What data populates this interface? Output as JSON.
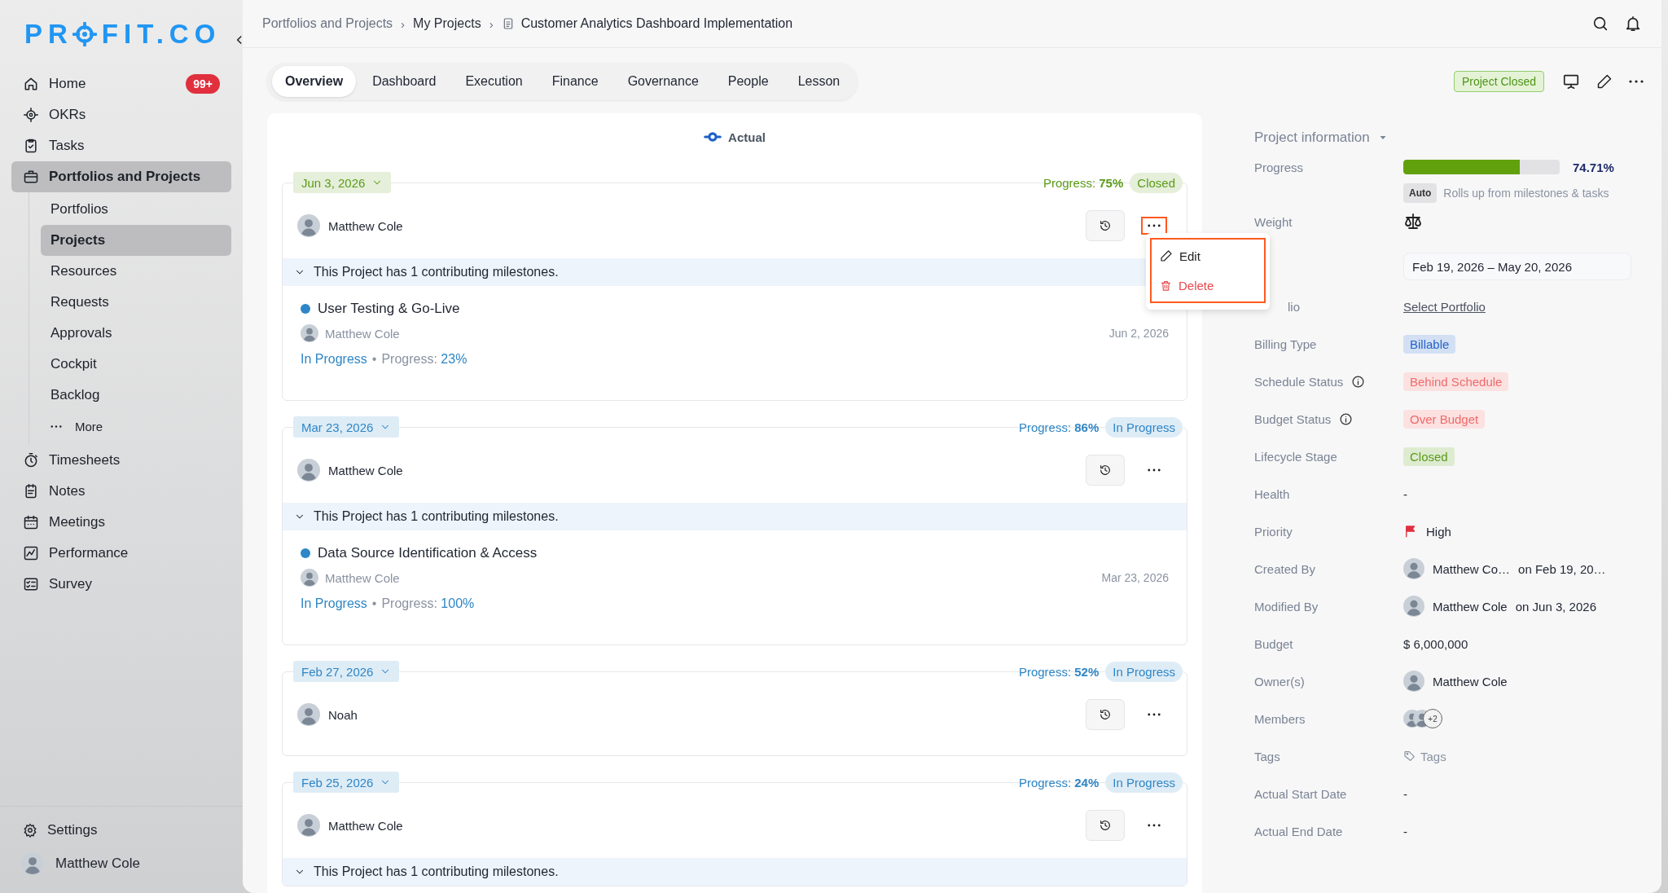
{
  "sidebar": {
    "logo": {
      "before": "PR",
      "after": "FIT.CO"
    },
    "items": [
      {
        "label": "Home",
        "badge": "99+",
        "selected": false
      },
      {
        "label": "OKRs",
        "selected": false
      },
      {
        "label": "Tasks",
        "selected": false
      },
      {
        "label": "Portfolios and Projects",
        "selected": true,
        "children": [
          {
            "label": "Portfolios",
            "selected": false
          },
          {
            "label": "Projects",
            "selected": true
          },
          {
            "label": "Resources",
            "selected": false
          },
          {
            "label": "Requests",
            "selected": false
          },
          {
            "label": "Approvals",
            "selected": false
          },
          {
            "label": "Cockpit",
            "selected": false
          },
          {
            "label": "Backlog",
            "selected": false
          },
          {
            "label": "More",
            "kind": "more",
            "selected": false
          }
        ]
      },
      {
        "label": "Timesheets",
        "selected": false
      },
      {
        "label": "Notes",
        "selected": false
      },
      {
        "label": "Meetings",
        "selected": false
      },
      {
        "label": "Performance",
        "selected": false
      },
      {
        "label": "Survey",
        "selected": false
      }
    ],
    "footer": {
      "settings": "Settings",
      "user": "Matthew Cole"
    }
  },
  "breadcrumb": {
    "separator": "›",
    "items": [
      "Portfolios and Projects",
      "My Projects",
      "Customer Analytics Dashboard Implementation"
    ]
  },
  "tabs": [
    {
      "label": "Overview",
      "selected": true
    },
    {
      "label": "Dashboard",
      "selected": false
    },
    {
      "label": "Execution",
      "selected": false
    },
    {
      "label": "Finance",
      "selected": false
    },
    {
      "label": "Governance",
      "selected": false
    },
    {
      "label": "People",
      "selected": false
    },
    {
      "label": "Lesson",
      "selected": false
    }
  ],
  "project_status": "Project Closed",
  "timeline": {
    "title": "Actual",
    "entries": [
      {
        "date": "Jun 3, 2026",
        "color": "#5b9c18",
        "progress_label": "Progress:",
        "progress": "75%",
        "status": "Closed",
        "owner": "Matthew Cole",
        "more_highlighted": true,
        "menu": {
          "highlighted": true,
          "items": [
            {
              "label": "Edit",
              "kind": "edit"
            },
            {
              "label": "Delete",
              "kind": "delete"
            }
          ]
        },
        "banner": "This Project has 1 contributing milestones.",
        "milestones": [
          {
            "title": "User Testing & Go-Live",
            "owner": "Matthew Cole",
            "date": "Jun 2, 2026",
            "status": "In Progress",
            "separator": "•",
            "progress_label": "Progress:",
            "progress": "23%"
          }
        ]
      },
      {
        "date": "Mar 23, 2026",
        "color": "#2f86c6",
        "progress_label": "Progress:",
        "progress": "86%",
        "status": "In Progress",
        "owner": "Matthew Cole",
        "more_highlighted": false,
        "banner": "This Project has 1 contributing milestones.",
        "milestones": [
          {
            "title": "Data Source Identification & Access",
            "owner": "Matthew Cole",
            "date": "Mar 23, 2026",
            "status": "In Progress",
            "separator": "•",
            "progress_label": "Progress:",
            "progress": "100%"
          }
        ]
      },
      {
        "date": "Feb 27, 2026",
        "color": "#2f86c6",
        "progress_label": "Progress:",
        "progress": "52%",
        "status": "In Progress",
        "owner": "Noah",
        "more_highlighted": false
      },
      {
        "date": "Feb 25, 2026",
        "color": "#2f86c6",
        "progress_label": "Progress:",
        "progress": "24%",
        "status": "In Progress",
        "owner": "Matthew Cole",
        "more_highlighted": false,
        "banner": "This Project has 1 contributing milestones."
      }
    ]
  },
  "info": {
    "title": "Project information",
    "rows": [
      {
        "kind": "progress",
        "label": "Progress",
        "level": 0.7471,
        "value": "74.71%",
        "badge": "Auto",
        "note": "Rolls up from milestones & tasks"
      },
      {
        "kind": "scale",
        "label": "Weight"
      },
      {
        "kind": "range",
        "value": "Feb 19, 2026 – May 20, 2026"
      },
      {
        "kind": "link",
        "label": "lio",
        "covered": true,
        "value": "Select Portfolio"
      },
      {
        "kind": "tag",
        "label": "Billing Type",
        "color": "#2563c9",
        "value": "Billable"
      },
      {
        "kind": "tag",
        "label": "Schedule Status",
        "info": true,
        "color": "#ef6b6b",
        "value": "Behind Schedule"
      },
      {
        "kind": "tag",
        "label": "Budget Status",
        "info": true,
        "color": "#ef6a6a",
        "value": "Over Budget"
      },
      {
        "kind": "tag",
        "label": "Lifecycle Stage",
        "color": "#5a9a17",
        "value": "Closed"
      },
      {
        "kind": "text",
        "label": "Health",
        "value": "-"
      },
      {
        "kind": "flag",
        "label": "Priority",
        "value": "High"
      },
      {
        "kind": "person",
        "label": "Created By",
        "value": "Matthew Co…",
        "suffix": "on Feb 19, 20…"
      },
      {
        "kind": "person",
        "label": "Modified By",
        "value": "Matthew Cole",
        "suffix": "on Jun 3, 2026"
      },
      {
        "kind": "text",
        "label": "Budget",
        "value": "$ 6,000,000"
      },
      {
        "kind": "person",
        "label": "Owner(s)",
        "value": "Matthew Cole"
      },
      {
        "kind": "members",
        "label": "Members",
        "value": "+2"
      },
      {
        "kind": "tags",
        "label": "Tags",
        "value": "Tags"
      },
      {
        "kind": "text",
        "label": "Actual Start Date",
        "value": "-"
      },
      {
        "kind": "text",
        "label": "Actual End Date",
        "value": "-"
      }
    ]
  }
}
